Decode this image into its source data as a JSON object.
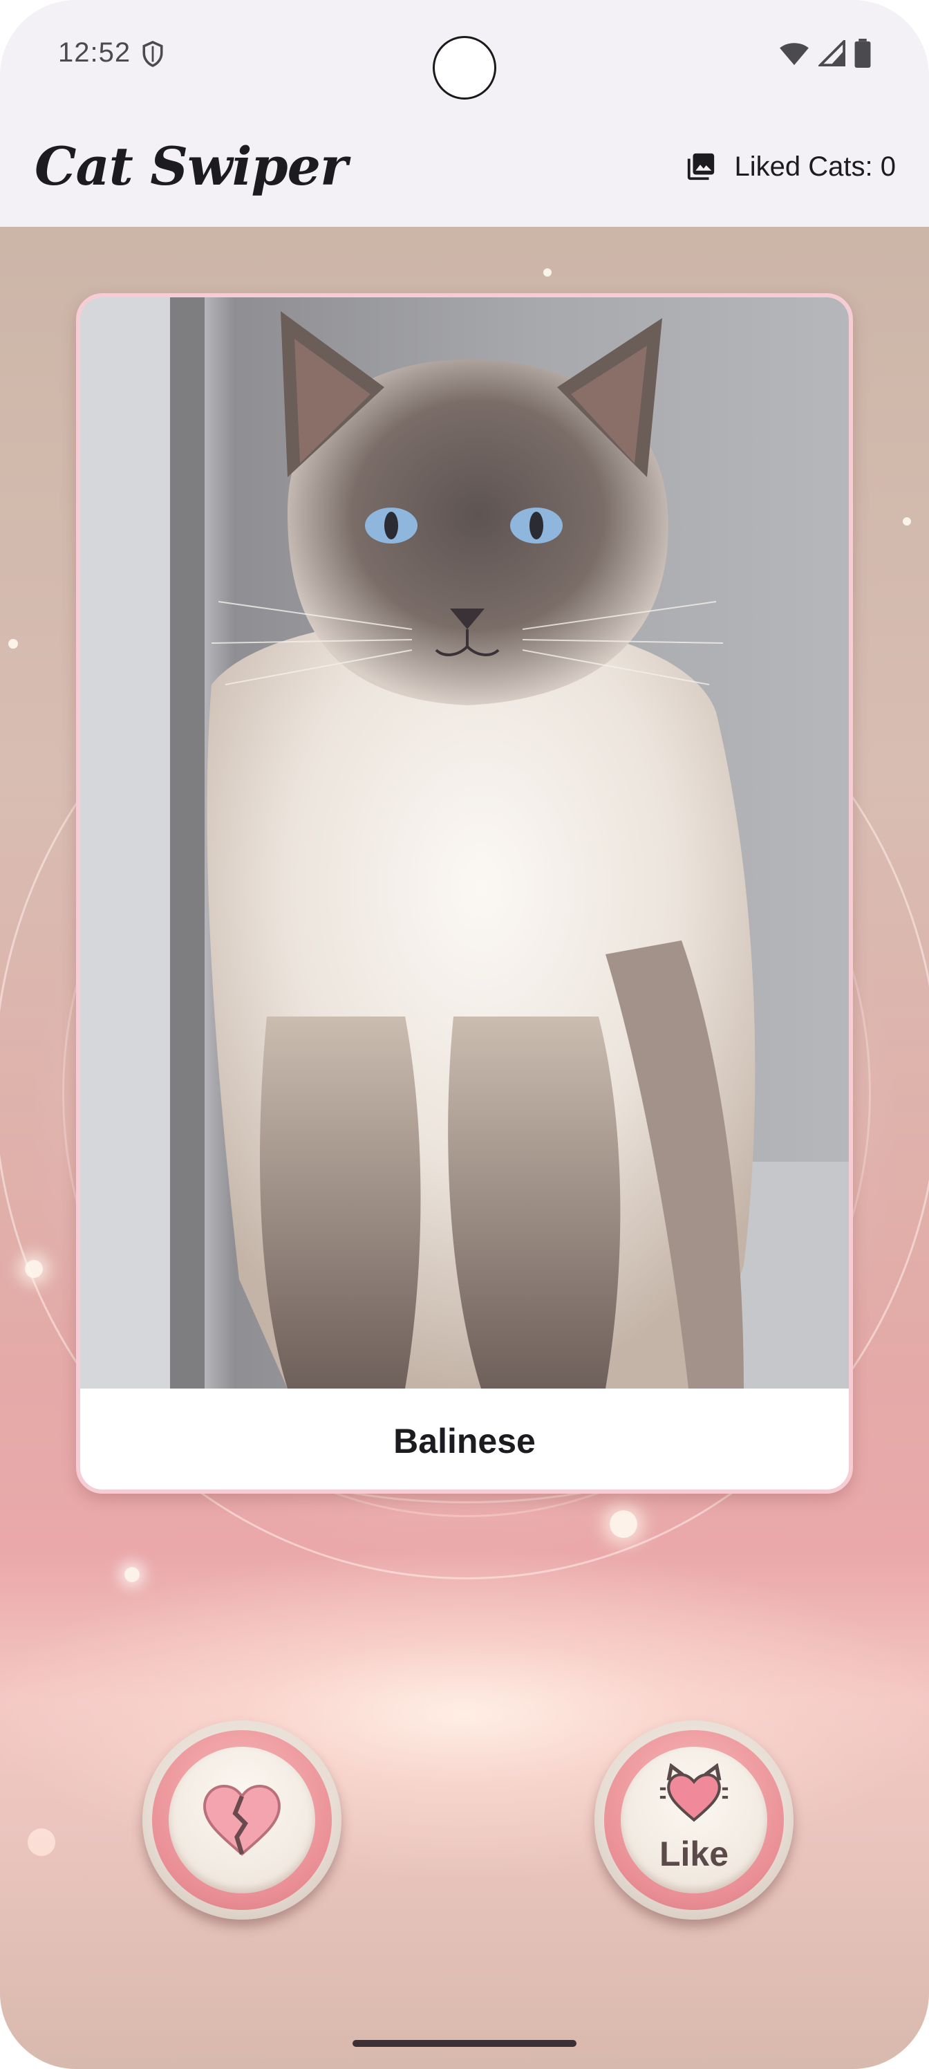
{
  "status_bar": {
    "time": "12:52",
    "icons": [
      "shield-icon",
      "wifi-icon",
      "signal-icon",
      "battery-icon"
    ]
  },
  "app_bar": {
    "title": "Cat Swiper",
    "liked_icon": "photo-library-icon",
    "liked_label": "Liked Cats: 0"
  },
  "card": {
    "breed_name": "Balinese",
    "photo": "balinese-cat-photo"
  },
  "actions": {
    "dislike_icon": "broken-heart-icon",
    "like_label": "Like",
    "like_icon": "cat-heart-icon"
  },
  "colors": {
    "app_bar_bg": "#f3f0f6",
    "card_border": "#f6cdd4",
    "button_pink": "#e98f95"
  }
}
